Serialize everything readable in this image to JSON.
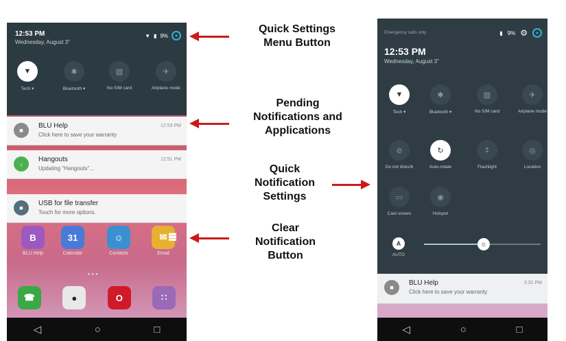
{
  "left_phone": {
    "time": "12:53 PM",
    "date": "Wednesday, August 3\"",
    "battery": "9%",
    "avatar_icon": "account-circle-icon",
    "tiles": [
      {
        "label": "Tech ▾",
        "icon": "wifi-icon",
        "active": true
      },
      {
        "label": "Bluetooth ▾",
        "icon": "bluetooth-icon",
        "active": false
      },
      {
        "label": "No SIM card",
        "icon": "no-sim-icon",
        "active": false
      },
      {
        "label": "Airplane mode",
        "icon": "airplane-icon",
        "active": false
      }
    ],
    "notifications": [
      {
        "title": "BLU Help",
        "body": "Click here to save your warranty",
        "time": "12:53 PM",
        "icon_color": "#8a8a8a",
        "icon": "help-icon"
      },
      {
        "title": "Hangouts",
        "body": "Updating \"Hangouts\"...",
        "time": "12:51 PM",
        "icon_color": "#4caf50",
        "icon": "download-icon"
      },
      {
        "title": "USB for file transfer",
        "body": "Touch for more options.",
        "time": "",
        "icon_color": "#546e7a",
        "icon": "usb-icon"
      }
    ],
    "apps": [
      {
        "label": "BLU Help",
        "color": "#9c5ac0",
        "glyph": "B"
      },
      {
        "label": "Calendar",
        "color": "#4a7ad8",
        "glyph": "31"
      },
      {
        "label": "Contacts",
        "color": "#3a90d0",
        "glyph": "☺"
      },
      {
        "label": "Email",
        "color": "#e8b030",
        "glyph": "✉"
      }
    ],
    "dock": [
      {
        "name": "phone-icon",
        "color": "#3aa845",
        "glyph": "☎"
      },
      {
        "name": "camera-icon",
        "color": "#e8e8e8",
        "glyph": "●"
      },
      {
        "name": "opera-icon",
        "color": "#d01a2a",
        "glyph": "O"
      },
      {
        "name": "apps-grid-icon",
        "color": "#9a6ab8",
        "glyph": "∷"
      }
    ]
  },
  "right_phone": {
    "top_text": "Emergency calls only",
    "battery": "9%",
    "time": "12:53 PM",
    "date": "Wednesday, August 3\"",
    "tiles_row1": [
      {
        "label": "Tech ▾",
        "icon": "wifi-icon",
        "active": true
      },
      {
        "label": "Bluetooth ▾",
        "icon": "bluetooth-icon",
        "active": false
      },
      {
        "label": "No SIM card",
        "icon": "no-sim-icon",
        "active": false
      },
      {
        "label": "Airplane mode",
        "icon": "airplane-icon",
        "active": false
      }
    ],
    "tiles_row2": [
      {
        "label": "Do not disturb",
        "icon": "do-not-disturb-icon",
        "active": false
      },
      {
        "label": "Auto-rotate",
        "icon": "rotate-icon",
        "active": true
      },
      {
        "label": "Flashlight",
        "icon": "flashlight-icon",
        "active": false
      },
      {
        "label": "Location",
        "icon": "location-icon",
        "active": false
      }
    ],
    "tiles_row3": [
      {
        "label": "Cast screen",
        "icon": "cast-icon",
        "active": false
      },
      {
        "label": "Hotspot",
        "icon": "hotspot-icon",
        "active": false
      }
    ],
    "brightness_label": "AUTO",
    "brightness_level": 0.5,
    "notification": {
      "title": "BLU Help",
      "body": "Click here to save your warranty",
      "time": "2:31 PM"
    }
  },
  "captions": {
    "quick_settings": "Quick Settings\nMenu Button",
    "pending": "Pending\nNotifications and\nApplications",
    "quick_notif": "Quick\nNotification\nSettings",
    "clear": "Clear\nNotification\nButton"
  },
  "nav": {
    "back": "◁",
    "home": "○",
    "recents": "□"
  },
  "colors": {
    "arrow": "#cc1a1a",
    "shade": "#2c3a42",
    "accent": "#2fb4d6"
  }
}
